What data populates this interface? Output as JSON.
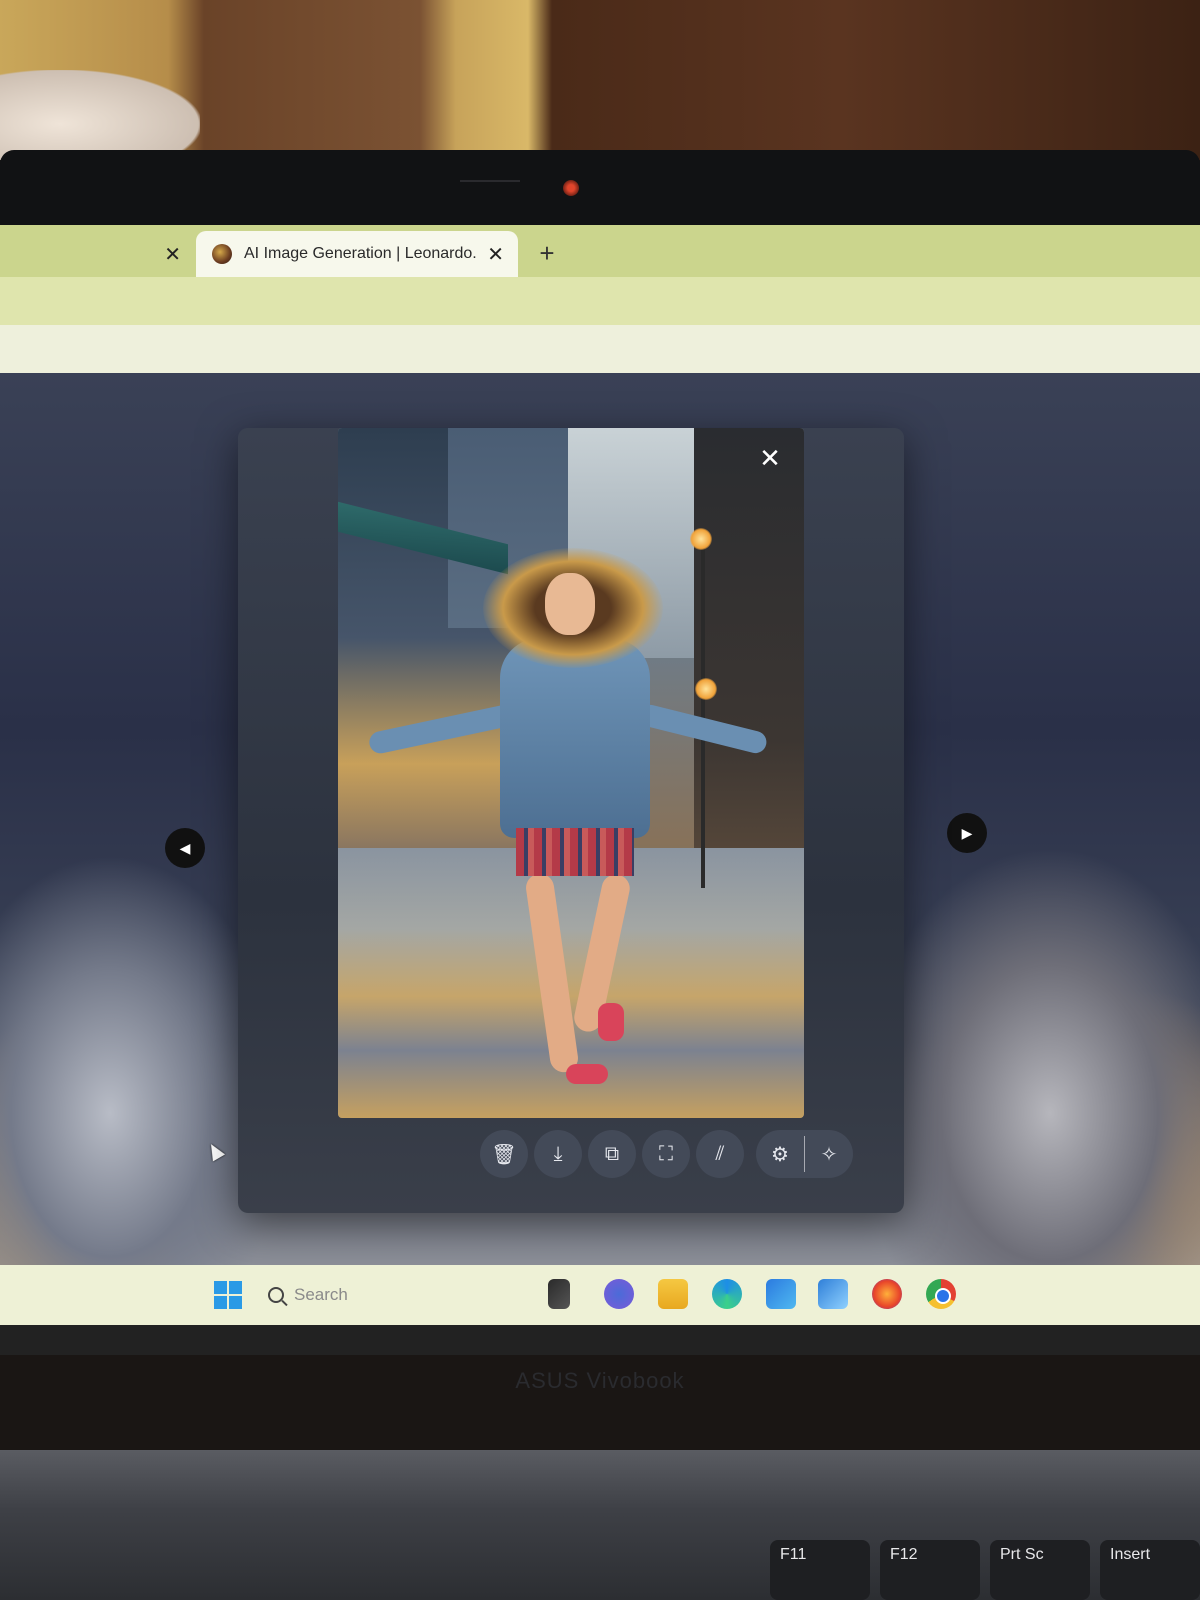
{
  "browser": {
    "tabs": [
      {
        "label": "",
        "close": "✕"
      },
      {
        "label": "AI Image Generation | Leonardo.",
        "close": "✕"
      }
    ],
    "new_tab": "+"
  },
  "viewer": {
    "close": "✕",
    "prev": "◀",
    "next": "▶",
    "actions": [
      {
        "icon": "trash-icon",
        "glyph": "🗑"
      },
      {
        "icon": "download-icon",
        "glyph": "⤓"
      },
      {
        "icon": "copy-icon",
        "glyph": "⧉"
      },
      {
        "icon": "expand-icon",
        "glyph": "⛶"
      },
      {
        "icon": "remove-background-icon",
        "glyph": "⫽"
      },
      {
        "icon": "settings-icon",
        "glyph": "⚙"
      },
      {
        "icon": "upscale-icon",
        "glyph": "✧"
      }
    ]
  },
  "taskbar": {
    "search_placeholder": "Search"
  },
  "laptop": {
    "brand": "ASUS Vivobook"
  },
  "keyboard": {
    "keys": [
      "F11",
      "F12",
      "Prt Sc",
      "Insert"
    ]
  }
}
